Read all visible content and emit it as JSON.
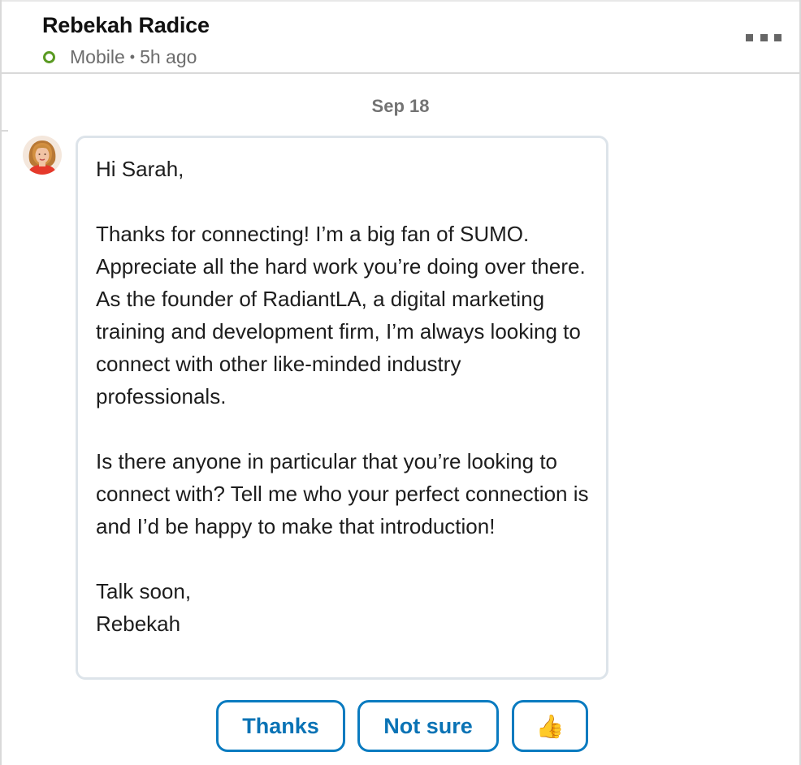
{
  "header": {
    "contact_name": "Rebekah Radice",
    "status_device": "Mobile",
    "status_separator": "•",
    "status_time": "5h ago"
  },
  "conversation": {
    "date_label": "Sep 18",
    "message": {
      "text": "Hi Sarah,\n\nThanks for connecting! I’m a big fan of SUMO. Appreciate all the hard work you’re doing over there. As the founder of RadiantLA, a digital marketing training and development firm, I’m always looking to connect with other like-minded industry professionals.\n\nIs there anyone in particular that you’re looking to connect with? Tell me who your perfect connection is and I’d be happy to make that introduction!\n\nTalk soon,\nRebekah"
    }
  },
  "quick_replies": [
    {
      "label": "Thanks"
    },
    {
      "label": "Not sure"
    },
    {
      "label": "👍",
      "icon": "thumbs-up-icon"
    }
  ],
  "icons": {
    "more": "more-options-icon",
    "status": "online-status-icon",
    "avatar": "avatar"
  },
  "colors": {
    "accent": "#0a73b5",
    "online": "#5a9a22",
    "bubble_border": "#dde4ea",
    "muted_text": "#6c6c6c"
  }
}
